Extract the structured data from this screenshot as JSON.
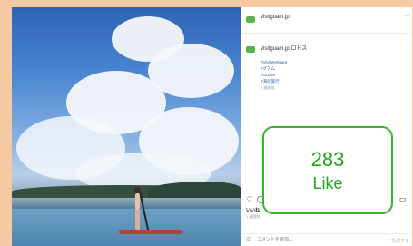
{
  "post": {
    "username": "visitguam.jp",
    "caption_handle": "visitguam.jp",
    "caption_lead": "ロドス",
    "hashtags": [
      "#VisitMyGuam",
      "#グアム",
      "#GUAM",
      "#海外旅行"
    ],
    "caption_time": "1 週間前",
    "likes_line": "いいね！",
    "date_line": "1 週間前",
    "comment_placeholder": "コメントを追加...",
    "post_button": "投稿する"
  },
  "like_overlay": {
    "count": "283",
    "label": "Like"
  },
  "colors": {
    "accent_green": "#22a51d",
    "page_bg": "#f5c9a2"
  },
  "icons": [
    "heart-icon",
    "comment-icon",
    "bookmark-icon",
    "smile-icon",
    "more-icon"
  ]
}
